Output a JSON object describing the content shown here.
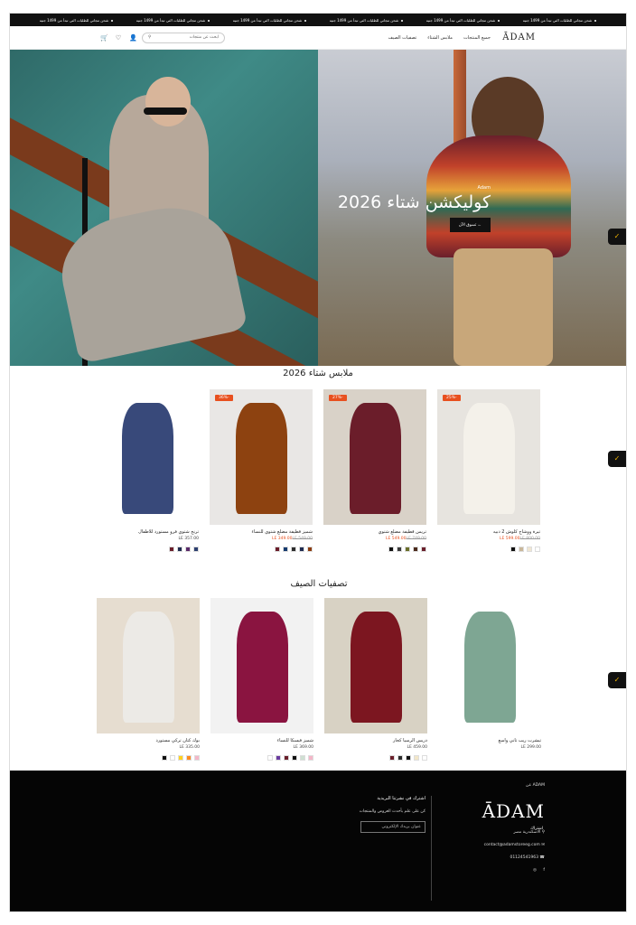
{
  "announcement": {
    "items": [
      "شحن مجاني للطلبات التي تبدأ من 1499 جنيه",
      "شحن مجاني للطلبات التي تبدأ من 1499 جنيه",
      "شحن مجاني للطلبات التي تبدأ من 1499 جنيه",
      "شحن مجاني للطلبات التي تبدأ من 1499 جنيه",
      "شحن مجاني للطلبات التي تبدأ من 1499 جنيه",
      "شحن مجاني للطلبات التي تبدأ من 1499 جنيه"
    ]
  },
  "header": {
    "logo": "ĀDAM",
    "nav": [
      "جميع المنتجات",
      "ملابس الشتاء",
      "تصفيات الصيف"
    ],
    "search_placeholder": "ابحث عن منتجات",
    "icons": [
      "search-icon",
      "user-icon",
      "heart-icon",
      "cart-icon"
    ]
  },
  "hero": {
    "brand": "Adam",
    "title": "كوليكشن شتاء 2026",
    "button": "تسوق الآن ←"
  },
  "winter": {
    "title": "ملابس شتاء 2026",
    "products": [
      {
        "name": "تيرة ووشاح كلوش 2 دبيه",
        "sale": "LE 599.00",
        "old": "LE 800.00",
        "badge": "-25%",
        "swatches": [
          "#ffffff",
          "#f0e6d2",
          "#c9b79a",
          "#111111"
        ],
        "bg": "#e7e4df",
        "fig": "#f4f1ea"
      },
      {
        "name": "تريس قطيفة مضلع شتوي",
        "sale": "LE 549.00",
        "old": "LE 749.00",
        "badge": "-27%",
        "swatches": [
          "#6a1f2b",
          "#4b2a1c",
          "#6a6f2a",
          "#3a3a3a",
          "#111111"
        ],
        "bg": "#d9d2c8",
        "fig": "#6b1d2a"
      },
      {
        "name": "شميز قطيفة مضلع شتوي للنساء",
        "sale": "LE 349.00",
        "old": "LE 549.00",
        "badge": "-36%",
        "swatches": [
          "#8a3b10",
          "#1f2b4f",
          "#2d2d2d",
          "#153a6e",
          "#6a1d2a"
        ],
        "bg": "#e9e7e5",
        "fig": "#8d4210"
      },
      {
        "name": "ترنج شتوي فرو مستورد للاطفال",
        "sale": "",
        "old": "LE 357.00",
        "badge": "",
        "swatches": [
          "#2d3f70",
          "#5a2a6a",
          "#1f2b4f",
          "#6a1f2b"
        ],
        "bg": "#ffffff",
        "fig": "#38497a"
      }
    ]
  },
  "summer": {
    "title": "تصفيات الصيف",
    "products": [
      {
        "name": "تيشرت ريب تاني واسع",
        "sale": "",
        "old": "LE 299.00",
        "swatches": [],
        "bg": "#ffffff",
        "fig": "#7ea693"
      },
      {
        "name": "دريس الرسيا كجار",
        "sale": "",
        "old": "LE 459.00",
        "swatches": [
          "#ffffff",
          "#f2e6c8",
          "#111111",
          "#2b2b2b",
          "#6a1f2b"
        ],
        "bg": "#d8d2c4",
        "fig": "#7c1620"
      },
      {
        "name": "شميز فيسكا للنساء",
        "sale": "",
        "old": "LE 369.00",
        "swatches": [
          "#f4b6c8",
          "#cfe0d2",
          "#111111",
          "#6a1f2b",
          "#6a3ca0",
          "#ffffff"
        ],
        "bg": "#f2f2f2",
        "fig": "#8a1440"
      },
      {
        "name": "بوك كتان تركي مستورد",
        "sale": "",
        "old": "LE 335.00",
        "swatches": [
          "#f4b6c8",
          "#ff8a1f",
          "#ffd21f",
          "#ffffff",
          "#111111"
        ],
        "bg": "#e6ddd0",
        "fig": "#eceae6"
      }
    ]
  },
  "footer": {
    "about_label": "عن ADAM",
    "logo": "ĀDAM",
    "address": "الاسكندرية مصر",
    "email": "contact@adamstoreeg.com",
    "phone": "01124541963",
    "newsletter_title": "اشترك في نشرتنا البريدية",
    "newsletter_text": "كن على علم بأحدث العروض والمنتجات",
    "email_placeholder": "عنوان بريدك الإلكتروني",
    "subscribe": "اشتراك"
  },
  "colors": {
    "accent": "#e8501f",
    "dark": "#111111",
    "tab_icon": "#f0b400"
  }
}
